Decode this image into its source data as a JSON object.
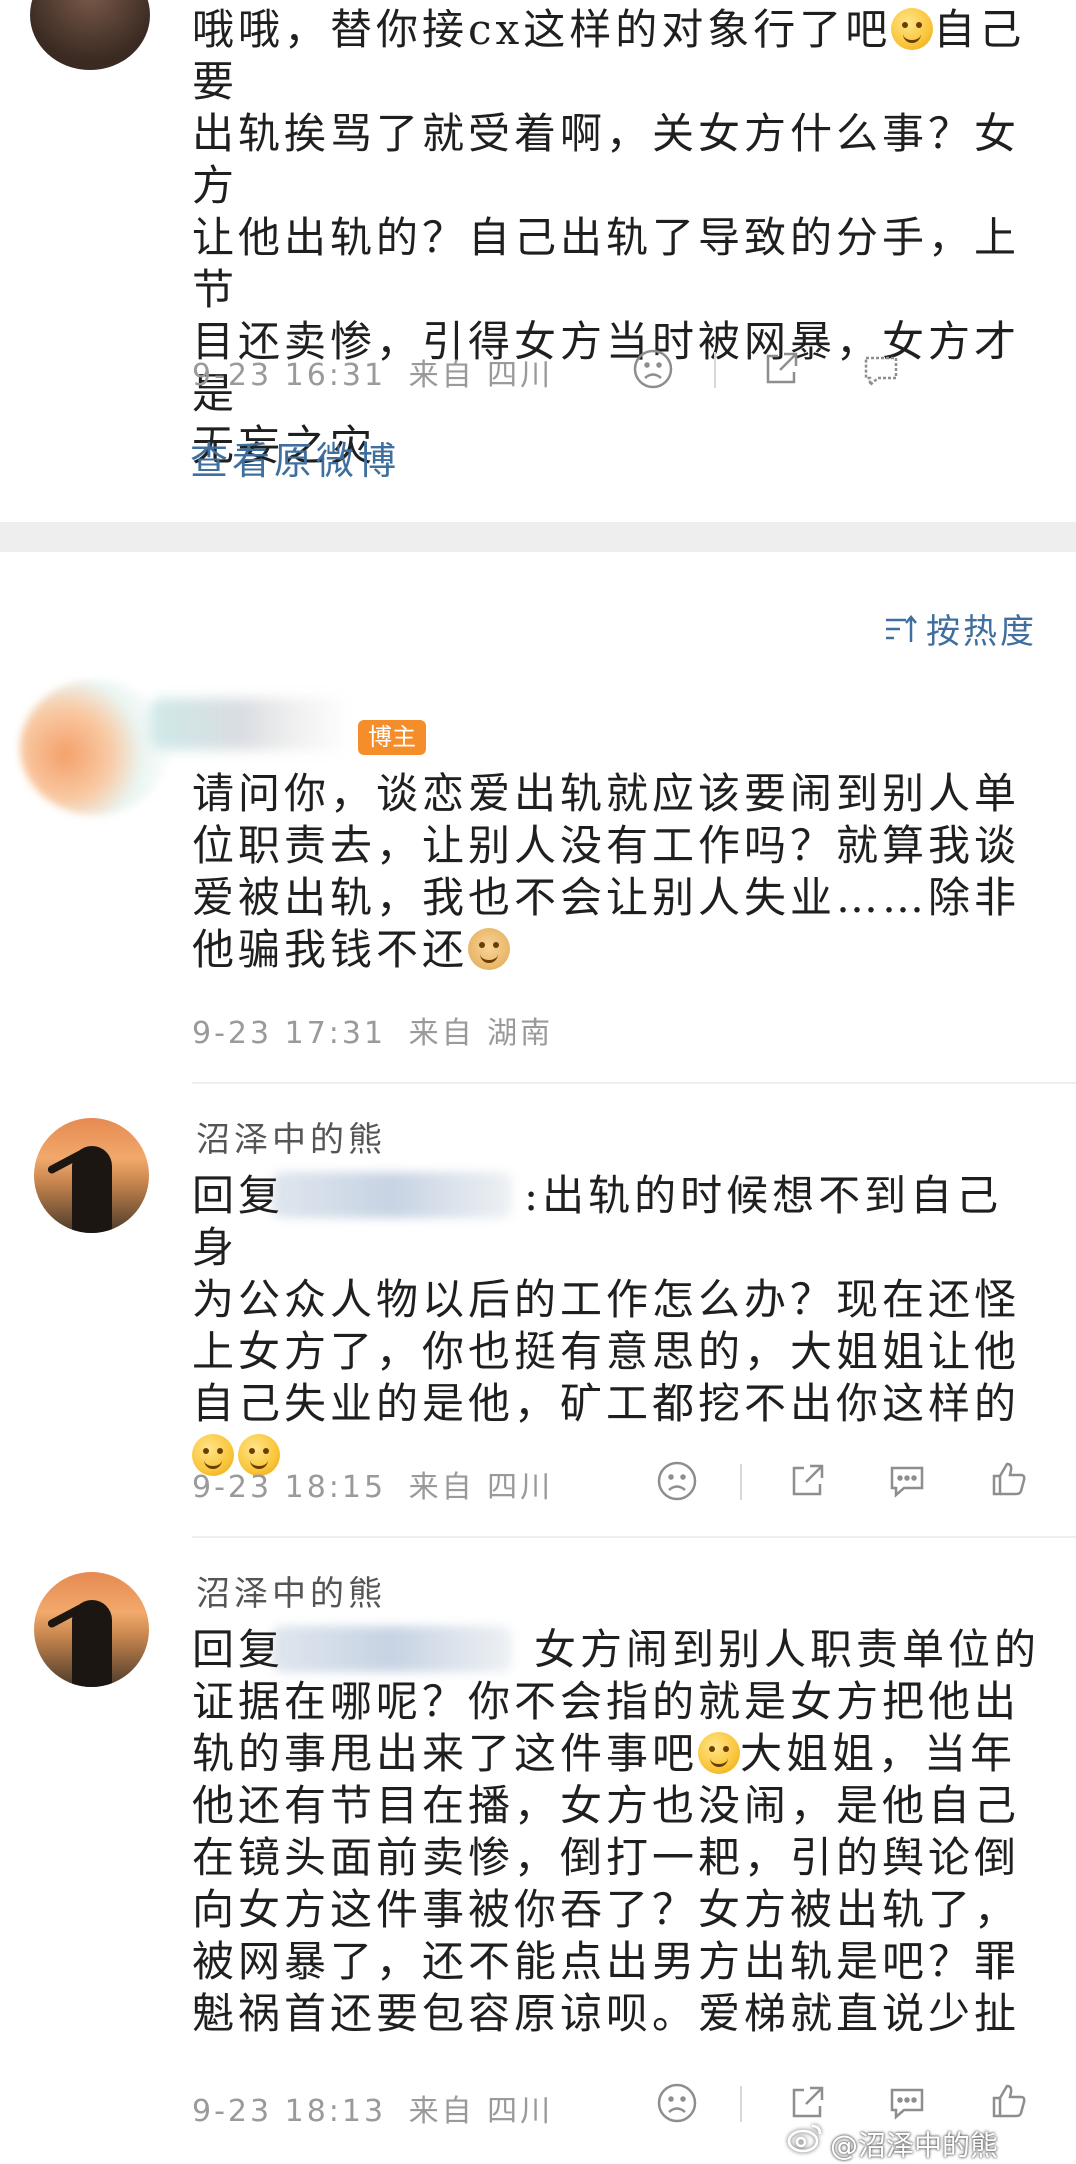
{
  "top_comment": {
    "text_line1": "哦哦，替你接cx这样的对象行了吧",
    "text_rest1": "自己要",
    "text_lines": "出轨挨骂了就受着啊，关女方什么事？女方\n让他出轨的？自己出轨了导致的分手，上节\n目还卖惨，引得女方当时被网暴，女方才是\n无妄之灾",
    "timestamp": "9-23 16:31",
    "location": "来自 四川",
    "icons": [
      "dislike-icon",
      "share-icon",
      "comment-icon"
    ]
  },
  "view_original_link": "查看原微博",
  "sort_label": "按热度",
  "comments": [
    {
      "badge": "博主",
      "text_main": "请问你，谈恋爱出轨就应该要闹到别人单\n位职责去，让别人没有工作吗？就算我谈\n爱被出轨，我也不会让别人失业……除非\n他骗我钱不还",
      "timestamp": "9-23 17:31",
      "location": "来自 湖南"
    },
    {
      "username": "沼泽中的熊",
      "reply_prefix": "回复",
      "text_after_blur": ":出轨的时候想不到自己身",
      "text_rest": "为公众人物以后的工作怎么办？现在还怪\n上女方了，你也挺有意思的，大姐姐让他\n自己失业的是他，矿工都挖不出你这样的",
      "timestamp": "9-23 18:15",
      "location": "来自 四川"
    },
    {
      "username": "沼泽中的熊",
      "reply_prefix": "回复",
      "text_after_blur": "女方闹到别人职责单位的",
      "text_line2": "证据在哪呢？你不会指的就是女方把他出",
      "text_line3a": "轨的事甩出来了这件事吧",
      "text_line3b": "大姐姐，当年",
      "text_rest": "他还有节目在播，女方也没闹，是他自己\n在镜头面前卖惨，倒打一耙，引的舆论倒\n向女方这件事被你吞了？女方被出轨了，\n被网暴了，还不能点出男方出轨是吧？罪\n魁祸首还要包容原谅呗。爱梯就直说少扯",
      "timestamp": "9-23 18:13",
      "location": "来自 四川"
    }
  ],
  "watermark": "@沼泽中的熊",
  "colors": {
    "link": "#3f6f9f",
    "badge": "#f58d2b",
    "meta": "#9a9a9a",
    "separator_band": "#eeeeee"
  }
}
